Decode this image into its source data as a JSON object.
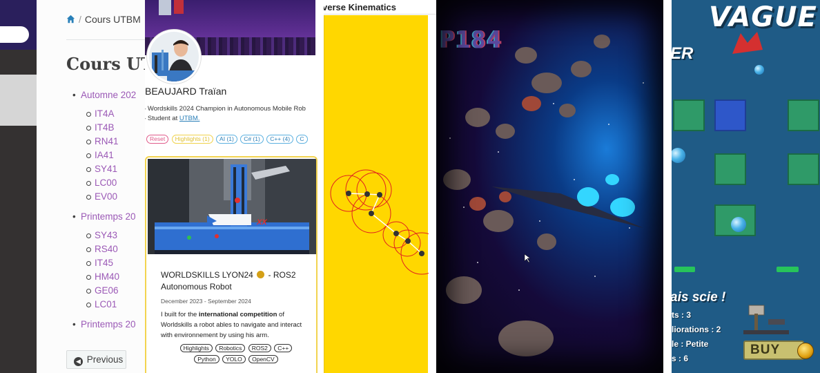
{
  "docs": {
    "breadcrumb_current": "Cours UTBM",
    "page_title": "Cours UTBM",
    "semesters": [
      {
        "label": "Automne 202",
        "courses": [
          "IT4A",
          "IT4B",
          "RN41",
          "IA41",
          "SY41",
          "LC00",
          "EV00"
        ]
      },
      {
        "label": "Printemps 20",
        "courses": [
          "SY43",
          "RS40",
          "IT45",
          "HM40",
          "GE06",
          "LC01"
        ]
      },
      {
        "label": "Printemps 20",
        "courses": []
      }
    ],
    "previous_button": "Previous"
  },
  "profile": {
    "name": "BEAUJARD Traïan",
    "bio_line1": "– Wordskills 2024 Champion in Autonomous Mobile Rob",
    "bio_line2_prefix": "– Student at ",
    "bio_link": "UTBM.",
    "filters": [
      "Reset",
      "Highlights (1)",
      "AI (1)",
      "C# (1)",
      "C++ (4)",
      "C"
    ],
    "card": {
      "title_part1": "WORLDSKILLS LYON24",
      "title_part2": "- ROS2",
      "title_line2": "Autonomous Robot",
      "date": "December 2023 - September 2024",
      "desc_prefix": "I built for the ",
      "desc_bold": "international competition",
      "desc_suffix": " of Worldskills a robot ables to navigate and interact with environnement by using his arm.",
      "tags_row1": [
        "Highlights",
        "Robotics",
        "ROS2",
        "C++"
      ],
      "tags_row2": [
        "Python",
        "YOLO",
        "OpenCV"
      ],
      "robot_logo": "XX"
    }
  },
  "ik_demo": {
    "title": "verse Kinematics",
    "accent": "#ffd700"
  },
  "space_game": {
    "score": "P184"
  },
  "tower_game": {
    "wave_title": "VAGUE :",
    "side_text": "ER",
    "item_title": "ais scie !",
    "stats": [
      "ts : 3",
      "liorations : 2",
      "le : Petite",
      "s : 6"
    ],
    "buy_label": "BUY"
  }
}
